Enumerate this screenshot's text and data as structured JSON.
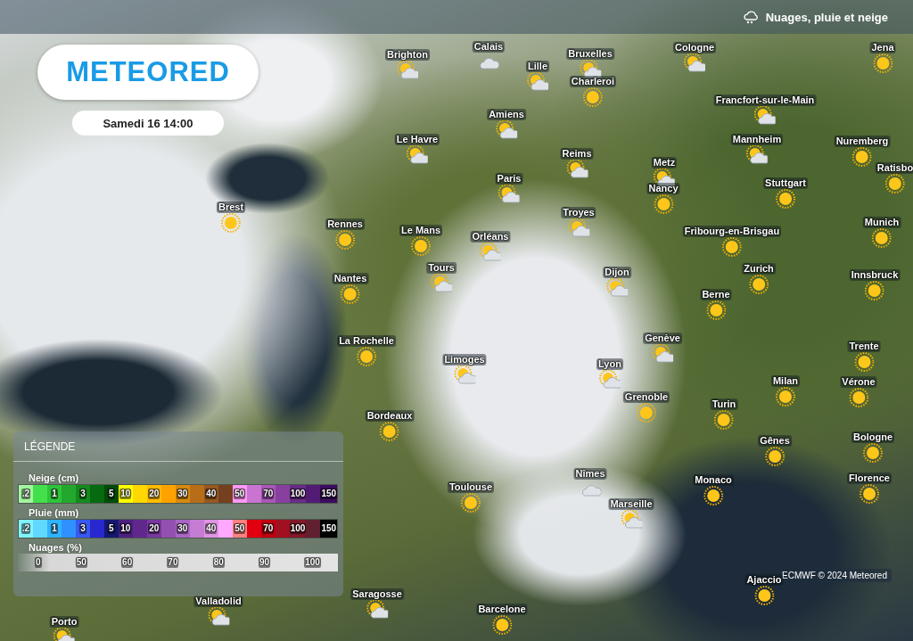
{
  "header": {
    "layer_title": "Nuages, pluie et neige"
  },
  "logo": {
    "text": "METEORED"
  },
  "date": "Samedi 16 14:00",
  "cities": [
    {
      "name": "Brighton",
      "kind": "partly"
    },
    {
      "name": "Calais",
      "kind": "cloud"
    },
    {
      "name": "Bruxelles",
      "kind": "partly"
    },
    {
      "name": "Lille",
      "kind": "partly"
    },
    {
      "name": "Charleroi",
      "kind": "sun"
    },
    {
      "name": "Cologne",
      "kind": "partly"
    },
    {
      "name": "Jena",
      "kind": "sun"
    },
    {
      "name": "Francfort-sur-le-Main",
      "kind": "partly"
    },
    {
      "name": "Amiens",
      "kind": "partly"
    },
    {
      "name": "Le Havre",
      "kind": "partly"
    },
    {
      "name": "Reims",
      "kind": "partly"
    },
    {
      "name": "Mannheim",
      "kind": "partly"
    },
    {
      "name": "Nuremberg",
      "kind": "sun"
    },
    {
      "name": "Ratisbo",
      "kind": "sun"
    },
    {
      "name": "Metz",
      "kind": "partly"
    },
    {
      "name": "Paris",
      "kind": "partly"
    },
    {
      "name": "Nancy",
      "kind": "sun"
    },
    {
      "name": "Stuttgart",
      "kind": "sun"
    },
    {
      "name": "Brest",
      "kind": "sun"
    },
    {
      "name": "Troyes",
      "kind": "partly"
    },
    {
      "name": "Rennes",
      "kind": "sun"
    },
    {
      "name": "Le Mans",
      "kind": "sun"
    },
    {
      "name": "Fribourg-en-Brisgau",
      "kind": "sun"
    },
    {
      "name": "Munich",
      "kind": "sun"
    },
    {
      "name": "Orléans",
      "kind": "partly"
    },
    {
      "name": "Tours",
      "kind": "partly"
    },
    {
      "name": "Dijon",
      "kind": "partly"
    },
    {
      "name": "Zurich",
      "kind": "sun"
    },
    {
      "name": "Innsbruck",
      "kind": "sun"
    },
    {
      "name": "Nantes",
      "kind": "sun"
    },
    {
      "name": "Berne",
      "kind": "sun"
    },
    {
      "name": "La Rochelle",
      "kind": "sun"
    },
    {
      "name": "Genève",
      "kind": "partly"
    },
    {
      "name": "Trente",
      "kind": "sun"
    },
    {
      "name": "Limoges",
      "kind": "partly"
    },
    {
      "name": "Lyon",
      "kind": "partly"
    },
    {
      "name": "Milan",
      "kind": "sun"
    },
    {
      "name": "Vérone",
      "kind": "sun"
    },
    {
      "name": "Grenoble",
      "kind": "sun"
    },
    {
      "name": "Turin",
      "kind": "sun"
    },
    {
      "name": "Bordeaux",
      "kind": "sun"
    },
    {
      "name": "Gênes",
      "kind": "sun"
    },
    {
      "name": "Bologne",
      "kind": "sun"
    },
    {
      "name": "Toulouse",
      "kind": "sun"
    },
    {
      "name": "Nîmes",
      "kind": "cloud"
    },
    {
      "name": "Monaco",
      "kind": "sun"
    },
    {
      "name": "Florence",
      "kind": "sun"
    },
    {
      "name": "Marseille",
      "kind": "partly"
    },
    {
      "name": "Ajaccio",
      "kind": "sun"
    },
    {
      "name": "Barcelone",
      "kind": "sun"
    },
    {
      "name": "Saragosse",
      "kind": "partly"
    },
    {
      "name": "Valladolid",
      "kind": "partly"
    },
    {
      "name": "Porto",
      "kind": "partly"
    }
  ],
  "legend": {
    "title": "LÉGENDE",
    "scales": [
      {
        "title": "Neige (cm)",
        "kind": "steps",
        "cells": [
          {
            "color": "#a4f5a0",
            "label": ".2"
          },
          {
            "color": "#44e04c"
          },
          {
            "color": "#2ec43a",
            "label": "1"
          },
          {
            "color": "#22a82c"
          },
          {
            "color": "#148a1e",
            "label": "3"
          },
          {
            "color": "#066a10"
          },
          {
            "color": "#034a08",
            "label": "5"
          },
          {
            "color": "#ffff00",
            "label": "10"
          },
          {
            "color": "#ffd800"
          },
          {
            "color": "#ffbc00",
            "label": "20"
          },
          {
            "color": "#ffa200"
          },
          {
            "color": "#d88a10",
            "label": "30"
          },
          {
            "color": "#b86e18"
          },
          {
            "color": "#985820",
            "label": "40"
          },
          {
            "color": "#744020"
          },
          {
            "color": "#ff98f8",
            "label": "50"
          },
          {
            "color": "#c874d0"
          },
          {
            "color": "#a858b8",
            "label": "70"
          },
          {
            "color": "#8840a0"
          },
          {
            "color": "#682c88",
            "label": "100"
          },
          {
            "color": "#521c74"
          },
          {
            "color": "#3c0c60",
            "label": "150"
          }
        ]
      },
      {
        "title": "Pluie (mm)",
        "kind": "steps",
        "cells": [
          {
            "color": "#80f4ff",
            "label": ".2"
          },
          {
            "color": "#60d8ff"
          },
          {
            "color": "#30b4ff",
            "label": "1"
          },
          {
            "color": "#3090ff"
          },
          {
            "color": "#3858f0",
            "label": "3"
          },
          {
            "color": "#2828d0"
          },
          {
            "color": "#141870",
            "label": "5"
          },
          {
            "color": "#4c2080",
            "label": "10"
          },
          {
            "color": "#60288c"
          },
          {
            "color": "#7838a0",
            "label": "20"
          },
          {
            "color": "#9450b0"
          },
          {
            "color": "#a866c4",
            "label": "30"
          },
          {
            "color": "#c47cd4"
          },
          {
            "color": "#e094e4",
            "label": "40"
          },
          {
            "color": "#ffa8ff"
          },
          {
            "color": "#ff8080",
            "label": "50"
          },
          {
            "color": "#e00010"
          },
          {
            "color": "#c00010",
            "label": "70"
          },
          {
            "color": "#a01020"
          },
          {
            "color": "#801828",
            "label": "100"
          },
          {
            "color": "#602030"
          },
          {
            "color": "#000000",
            "label": "150"
          }
        ]
      },
      {
        "title": "Nuages (%)",
        "kind": "gradient",
        "labels": [
          "0",
          "50",
          "60",
          "70",
          "80",
          "90",
          "100"
        ]
      }
    ]
  },
  "attribution": "ECMWF © 2024 Meteored"
}
